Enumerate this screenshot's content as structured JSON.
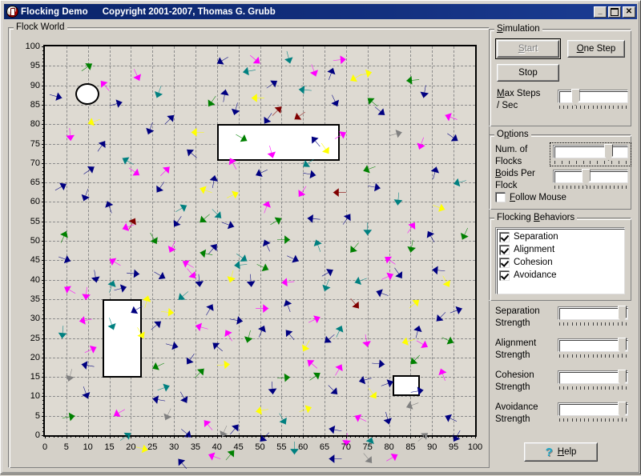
{
  "window": {
    "title": "Flocking Demo",
    "copyright": "Copyright 2001-2007, Thomas G. Grubb",
    "icon": "app-icon",
    "controls": {
      "minimize": "_",
      "maximize": "",
      "close": "✕"
    }
  },
  "flock_world": {
    "group_label": "Flock World"
  },
  "chart_data": {
    "type": "scatter",
    "title": "Flock World",
    "xlabel": "",
    "ylabel": "",
    "xlim": [
      0,
      100
    ],
    "ylim": [
      0,
      100
    ],
    "grid": true,
    "major_step": 5,
    "minor_step": 1,
    "xticks": [
      0,
      5,
      10,
      15,
      20,
      25,
      30,
      35,
      40,
      45,
      50,
      55,
      60,
      65,
      70,
      75,
      80,
      85,
      90,
      95,
      100
    ],
    "yticks": [
      0,
      5,
      10,
      15,
      20,
      25,
      30,
      35,
      40,
      45,
      50,
      55,
      60,
      65,
      70,
      75,
      80,
      85,
      90,
      95,
      100
    ],
    "background": "#dedad2",
    "gridline_color": "#8c8c8c",
    "obstacles": [
      {
        "shape": "circle",
        "x": 7.0,
        "y": 85.0,
        "w": 5.6,
        "h": 5.6
      },
      {
        "shape": "rect",
        "x": 40.0,
        "y": 70.5,
        "w": 28.5,
        "h": 9.5
      },
      {
        "shape": "rect",
        "x": 13.5,
        "y": 14.8,
        "w": 9.0,
        "h": 20.2
      },
      {
        "shape": "rect",
        "x": 80.8,
        "y": 10.0,
        "w": 6.3,
        "h": 5.4
      }
    ],
    "flock_colors": [
      "#000080",
      "#ff00ff",
      "#008080",
      "#ffff00",
      "#800000",
      "#808080",
      "#008000",
      "#0000cd"
    ],
    "boids": [
      [
        24.0,
        79.5,
        200,
        "#000080"
      ],
      [
        11.5,
        72.0,
        55,
        "#000080"
      ],
      [
        9.0,
        64.0,
        200,
        "#000080"
      ],
      [
        14.5,
        64.0,
        340,
        "#000080"
      ],
      [
        21.0,
        60.0,
        30,
        "#800000"
      ],
      [
        18.0,
        57.5,
        250,
        "#ff00ff"
      ],
      [
        15.0,
        50.5,
        300,
        "#ff00ff"
      ],
      [
        12.0,
        45.0,
        170,
        "#000080"
      ],
      [
        9.5,
        41.0,
        185,
        "#ff00ff"
      ],
      [
        16.0,
        45.5,
        20,
        "#008080"
      ],
      [
        22.0,
        47.0,
        95,
        "#000080"
      ],
      [
        26.0,
        54.0,
        150,
        "#008000"
      ],
      [
        30.0,
        58.0,
        215,
        "#000080"
      ],
      [
        33.0,
        63.0,
        60,
        "#008080"
      ],
      [
        36.0,
        67.0,
        290,
        "#ffff00"
      ],
      [
        39.5,
        70.0,
        10,
        "#000080"
      ],
      [
        43.0,
        74.0,
        330,
        "#ff00ff"
      ],
      [
        47.0,
        78.0,
        120,
        "#008000"
      ],
      [
        51.0,
        82.0,
        215,
        "#000080"
      ],
      [
        55.0,
        86.0,
        45,
        "#800000"
      ],
      [
        59.0,
        90.0,
        275,
        "#008080"
      ],
      [
        63.0,
        93.0,
        160,
        "#ff00ff"
      ],
      [
        67.0,
        95.0,
        20,
        "#000080"
      ],
      [
        71.0,
        92.0,
        240,
        "#ffff00"
      ],
      [
        75.0,
        88.0,
        310,
        "#008000"
      ],
      [
        79.0,
        84.0,
        130,
        "#000080"
      ],
      [
        83.0,
        80.0,
        75,
        "#808080"
      ],
      [
        87.0,
        76.0,
        200,
        "#ff00ff"
      ],
      [
        91.0,
        72.0,
        15,
        "#000080"
      ],
      [
        95.0,
        68.0,
        255,
        "#008080"
      ],
      [
        93.0,
        62.0,
        110,
        "#ffff00"
      ],
      [
        89.0,
        57.0,
        330,
        "#000080"
      ],
      [
        85.0,
        52.0,
        190,
        "#008000"
      ],
      [
        81.0,
        47.0,
        65,
        "#ff00ff"
      ],
      [
        77.0,
        43.0,
        290,
        "#000080"
      ],
      [
        73.0,
        39.0,
        140,
        "#800000"
      ],
      [
        69.0,
        35.0,
        25,
        "#008080"
      ],
      [
        65.0,
        31.0,
        230,
        "#000080"
      ],
      [
        61.0,
        27.0,
        310,
        "#ff00ff"
      ],
      [
        57.0,
        23.0,
        85,
        "#008000"
      ],
      [
        53.0,
        19.0,
        175,
        "#000080"
      ],
      [
        49.0,
        15.0,
        260,
        "#ffff00"
      ],
      [
        45.0,
        12.0,
        40,
        "#000080"
      ],
      [
        41.0,
        9.0,
        205,
        "#808080"
      ],
      [
        37.0,
        13.0,
        320,
        "#ff00ff"
      ],
      [
        33.0,
        17.0,
        150,
        "#000080"
      ],
      [
        29.0,
        21.0,
        70,
        "#008080"
      ],
      [
        25.0,
        25.0,
        245,
        "#008000"
      ],
      [
        31.0,
        30.0,
        105,
        "#000080"
      ],
      [
        35.0,
        35.0,
        285,
        "#ff00ff"
      ],
      [
        39.0,
        40.0,
        30,
        "#000080"
      ],
      [
        43.0,
        45.0,
        195,
        "#ffff00"
      ],
      [
        47.0,
        50.0,
        125,
        "#008080"
      ],
      [
        51.0,
        55.0,
        335,
        "#000080"
      ],
      [
        55.0,
        60.0,
        60,
        "#008000"
      ],
      [
        59.0,
        65.0,
        215,
        "#ff00ff"
      ],
      [
        63.0,
        70.0,
        100,
        "#000080"
      ],
      [
        67.0,
        66.0,
        270,
        "#800000"
      ],
      [
        71.0,
        61.0,
        35,
        "#000080"
      ],
      [
        75.0,
        56.0,
        180,
        "#008080"
      ],
      [
        79.0,
        51.0,
        305,
        "#ff00ff"
      ],
      [
        83.0,
        46.0,
        145,
        "#000080"
      ],
      [
        87.0,
        41.0,
        50,
        "#ffff00"
      ],
      [
        91.0,
        36.0,
        225,
        "#000080"
      ],
      [
        95.0,
        31.0,
        115,
        "#008000"
      ],
      [
        92.0,
        25.0,
        340,
        "#ff00ff"
      ],
      [
        88.0,
        20.0,
        80,
        "#000080"
      ],
      [
        84.0,
        16.0,
        250,
        "#808080"
      ],
      [
        80.0,
        12.0,
        165,
        "#000080"
      ],
      [
        76.0,
        9.0,
        20,
        "#008080"
      ],
      [
        72.0,
        14.0,
        295,
        "#ff00ff"
      ],
      [
        68.0,
        19.0,
        135,
        "#000080"
      ],
      [
        64.0,
        24.0,
        55,
        "#008000"
      ],
      [
        60.0,
        29.0,
        210,
        "#ffff00"
      ],
      [
        56.0,
        34.0,
        320,
        "#000080"
      ],
      [
        52.0,
        39.0,
        90,
        "#ff00ff"
      ],
      [
        48.0,
        44.0,
        175,
        "#000080"
      ],
      [
        44.0,
        49.0,
        265,
        "#008080"
      ],
      [
        40.0,
        54.0,
        40,
        "#000080"
      ],
      [
        36.0,
        59.0,
        230,
        "#008000"
      ],
      [
        32.0,
        50.0,
        300,
        "#ff00ff"
      ],
      [
        28.0,
        46.0,
        120,
        "#000080"
      ],
      [
        24.0,
        42.0,
        15,
        "#ffff00"
      ],
      [
        20.0,
        38.0,
        240,
        "#000080"
      ],
      [
        16.0,
        34.0,
        160,
        "#008080"
      ],
      [
        12.0,
        30.0,
        65,
        "#ff00ff"
      ],
      [
        8.5,
        26.0,
        280,
        "#000080"
      ],
      [
        5.5,
        22.0,
        195,
        "#808080"
      ],
      [
        6.0,
        50.0,
        110,
        "#000080"
      ],
      [
        5.0,
        57.0,
        25,
        "#008000"
      ],
      [
        4.5,
        44.0,
        300,
        "#ff00ff"
      ],
      [
        26.0,
        88.0,
        200,
        "#008080"
      ],
      [
        30.0,
        84.0,
        45,
        "#000080"
      ],
      [
        34.0,
        80.0,
        270,
        "#ffff00"
      ],
      [
        22.0,
        92.0,
        155,
        "#ff00ff"
      ],
      [
        18.0,
        87.0,
        75,
        "#000080"
      ],
      [
        38.0,
        86.0,
        215,
        "#008000"
      ],
      [
        42.0,
        90.0,
        10,
        "#000080"
      ],
      [
        46.0,
        94.0,
        260,
        "#008080"
      ],
      [
        50.0,
        96.0,
        130,
        "#ff00ff"
      ],
      [
        54.0,
        92.0,
        55,
        "#000080"
      ],
      [
        58.0,
        83.0,
        235,
        "#800000"
      ],
      [
        62.0,
        79.0,
        320,
        "#000080"
      ],
      [
        66.0,
        75.0,
        145,
        "#ffff00"
      ],
      [
        70.0,
        80.0,
        60,
        "#ff00ff"
      ],
      [
        74.0,
        71.0,
        250,
        "#008000"
      ],
      [
        78.0,
        67.0,
        100,
        "#000080"
      ],
      [
        82.0,
        63.0,
        185,
        "#008080"
      ],
      [
        86.0,
        59.0,
        35,
        "#ff00ff"
      ],
      [
        90.0,
        48.0,
        275,
        "#000080"
      ],
      [
        94.0,
        44.0,
        150,
        "#ffff00"
      ],
      [
        97.0,
        39.0,
        70,
        "#000080"
      ],
      [
        97.0,
        55.0,
        205,
        "#008000"
      ],
      [
        96.0,
        78.0,
        125,
        "#000080"
      ],
      [
        93.0,
        84.0,
        290,
        "#ff00ff"
      ],
      [
        27.0,
        36.0,
        50,
        "#000080"
      ],
      [
        31.0,
        41.0,
        230,
        "#008080"
      ],
      [
        35.0,
        46.0,
        140,
        "#ff00ff"
      ],
      [
        39.0,
        31.0,
        310,
        "#000080"
      ],
      [
        43.0,
        26.0,
        85,
        "#ffff00"
      ],
      [
        47.0,
        31.0,
        195,
        "#008000"
      ],
      [
        51.0,
        35.0,
        25,
        "#000080"
      ],
      [
        55.0,
        45.0,
        265,
        "#ff00ff"
      ],
      [
        59.0,
        50.0,
        115,
        "#000080"
      ],
      [
        63.0,
        55.0,
        340,
        "#008080"
      ],
      [
        67.0,
        48.0,
        60,
        "#000080"
      ],
      [
        71.0,
        52.0,
        220,
        "#008000"
      ],
      [
        75.0,
        30.0,
        170,
        "#ff00ff"
      ],
      [
        79.0,
        26.0,
        95,
        "#000080"
      ],
      [
        83.0,
        31.0,
        255,
        "#ffff00"
      ],
      [
        87.0,
        35.0,
        15,
        "#000080"
      ],
      [
        28.0,
        13.0,
        205,
        "#808080"
      ],
      [
        34.0,
        9.0,
        130,
        "#000080"
      ],
      [
        38.0,
        5.0,
        290,
        "#ff00ff"
      ],
      [
        44.0,
        6.0,
        40,
        "#008000"
      ],
      [
        50.0,
        8.0,
        225,
        "#000080"
      ],
      [
        56.0,
        12.0,
        150,
        "#008080"
      ],
      [
        62.0,
        16.0,
        70,
        "#ffff00"
      ],
      [
        66.0,
        11.0,
        280,
        "#000080"
      ],
      [
        70.0,
        7.0,
        185,
        "#ff00ff"
      ],
      [
        24.0,
        6.0,
        105,
        "#ffff00"
      ],
      [
        31.0,
        4.0,
        320,
        "#000080"
      ],
      [
        20.0,
        10.0,
        55,
        "#008080"
      ],
      [
        16.0,
        14.0,
        240,
        "#ff00ff"
      ],
      [
        10.0,
        18.0,
        160,
        "#000080"
      ],
      [
        7.0,
        14.0,
        80,
        "#008000"
      ],
      [
        26.0,
        66.0,
        215,
        "#000080"
      ],
      [
        22.0,
        70.0,
        125,
        "#ff00ff"
      ],
      [
        18.0,
        74.0,
        300,
        "#008080"
      ],
      [
        14.0,
        78.0,
        35,
        "#000080"
      ],
      [
        10.0,
        82.0,
        250,
        "#ffff00"
      ],
      [
        6.0,
        78.0,
        175,
        "#ff00ff"
      ],
      [
        5.0,
        68.0,
        60,
        "#000080"
      ],
      [
        36.0,
        52.0,
        280,
        "#008000"
      ],
      [
        44.0,
        58.0,
        110,
        "#000080"
      ],
      [
        52.0,
        64.0,
        20,
        "#ff00ff"
      ],
      [
        60.0,
        72.0,
        235,
        "#008080"
      ],
      [
        68.0,
        86.0,
        155,
        "#000080"
      ],
      [
        76.0,
        94.0,
        75,
        "#ffff00"
      ],
      [
        84.0,
        92.0,
        265,
        "#008000"
      ],
      [
        88.0,
        88.0,
        190,
        "#000080"
      ],
      [
        29.0,
        72.0,
        45,
        "#ff00ff"
      ],
      [
        33.0,
        76.0,
        310,
        "#000080"
      ],
      [
        41.0,
        60.0,
        135,
        "#008080"
      ],
      [
        45.0,
        66.0,
        65,
        "#ffff00"
      ],
      [
        49.0,
        70.0,
        245,
        "#000080"
      ],
      [
        53.0,
        74.0,
        165,
        "#ff00ff"
      ],
      [
        57.0,
        55.0,
        90,
        "#008000"
      ],
      [
        61.0,
        60.0,
        275,
        "#000080"
      ],
      [
        65.0,
        43.0,
        200,
        "#008080"
      ],
      [
        69.0,
        26.0,
        30,
        "#ff00ff"
      ],
      [
        73.0,
        22.0,
        255,
        "#000080"
      ],
      [
        77.0,
        18.0,
        145,
        "#ffff00"
      ],
      [
        81.0,
        22.0,
        70,
        "#000080"
      ],
      [
        85.0,
        26.0,
        225,
        "#008000"
      ],
      [
        89.0,
        30.0,
        120,
        "#ff00ff"
      ],
      [
        93.0,
        14.0,
        295,
        "#000080"
      ],
      [
        89.0,
        10.0,
        50,
        "#808080"
      ],
      [
        95.0,
        8.0,
        210,
        "#000080"
      ],
      [
        76.0,
        3.0,
        140,
        "#808080"
      ],
      [
        82.0,
        5.0,
        60,
        "#ff00ff"
      ],
      [
        66.0,
        4.0,
        270,
        "#000080"
      ],
      [
        58.0,
        5.0,
        180,
        "#008080"
      ],
      [
        46.0,
        36.0,
        100,
        "#000080"
      ],
      [
        42.0,
        34.0,
        330,
        "#ff00ff"
      ],
      [
        37.0,
        25.0,
        45,
        "#008000"
      ],
      [
        33.0,
        26.0,
        215,
        "#000080"
      ],
      [
        23.0,
        32.0,
        150,
        "#ffff00"
      ],
      [
        19.0,
        44.0,
        75,
        "#000080"
      ],
      [
        8.0,
        36.0,
        260,
        "#ff00ff"
      ],
      [
        4.0,
        32.0,
        185,
        "#008080"
      ],
      [
        4.0,
        88.0,
        105,
        "#000080"
      ],
      [
        13.0,
        92.0,
        320,
        "#ff00ff"
      ],
      [
        11.0,
        96.0,
        55,
        "#008000"
      ],
      [
        40.0,
        96.0,
        240,
        "#000080"
      ],
      [
        57.0,
        96.0,
        165,
        "#008080"
      ],
      [
        70.0,
        97.0,
        85,
        "#ff00ff"
      ],
      [
        48.0,
        88.0,
        270,
        "#ffff00"
      ],
      [
        44.0,
        84.0,
        195,
        "#000080"
      ],
      [
        52.0,
        48.0,
        115,
        "#008000"
      ],
      [
        56.0,
        41.0,
        340,
        "#000080"
      ],
      [
        64.0,
        37.0,
        65,
        "#ff00ff"
      ],
      [
        72.0,
        45.0,
        250,
        "#008080"
      ],
      [
        36.0,
        44.0,
        175,
        "#000080"
      ],
      [
        30.0,
        38.0,
        95,
        "#ffff00"
      ],
      [
        25.0,
        18.0,
        280,
        "#000080"
      ],
      [
        29.0,
        52.0,
        205,
        "#ff00ff"
      ]
    ]
  },
  "simulation": {
    "group_label": "Simulation",
    "group_label_accel": "S",
    "start_button": "Start",
    "start_accel": "S",
    "start_enabled": false,
    "one_step_button": "One Step",
    "one_step_accel": "O",
    "stop_button": "Stop",
    "max_steps_label_line1": "Max Steps",
    "max_steps_label_line2": "/ Sec",
    "max_steps_accel": "M",
    "max_steps_value_pct": 22
  },
  "options": {
    "group_label": "Options",
    "group_label_accel": "O",
    "num_flocks_label_line1": "Num. of",
    "num_flocks_label_line2": "Flocks",
    "num_flocks_value_pct": 79,
    "num_flocks_focused": true,
    "boids_per_flock_label_line1": "Boids Per",
    "boids_per_flock_label_line2": "Flock",
    "boids_accel": "B",
    "boids_per_flock_value_pct": 44,
    "follow_mouse_label": "Follow Mouse",
    "follow_mouse_accel": "F",
    "follow_mouse_checked": false
  },
  "flocking_behaviors": {
    "group_label": "Flocking Behaviors",
    "group_label_accel": "B",
    "items": [
      {
        "label": "Separation",
        "checked": true
      },
      {
        "label": "Alignment",
        "checked": true
      },
      {
        "label": "Cohesion",
        "checked": true
      },
      {
        "label": "Avoidance",
        "checked": true
      }
    ]
  },
  "strengths": [
    {
      "label_line1": "Separation",
      "label_line2": "Strength",
      "value_pct": 100
    },
    {
      "label_line1": "Alignment",
      "label_line2": "Strength",
      "value_pct": 100
    },
    {
      "label_line1": "Cohesion",
      "label_line2": "Strength",
      "value_pct": 100
    },
    {
      "label_line1": "Avoidance",
      "label_line2": "Strength",
      "value_pct": 100
    }
  ],
  "help": {
    "label": "Help",
    "accel": "H",
    "icon": "question-mark-icon",
    "icon_glyph": "?",
    "icon_color": "#1aa6c8"
  },
  "colors": {
    "face": "#d4d0c8",
    "titlebar": "#0a246a",
    "plot_bg": "#dedad2",
    "text": "#000000",
    "disabled_text": "#808080"
  }
}
